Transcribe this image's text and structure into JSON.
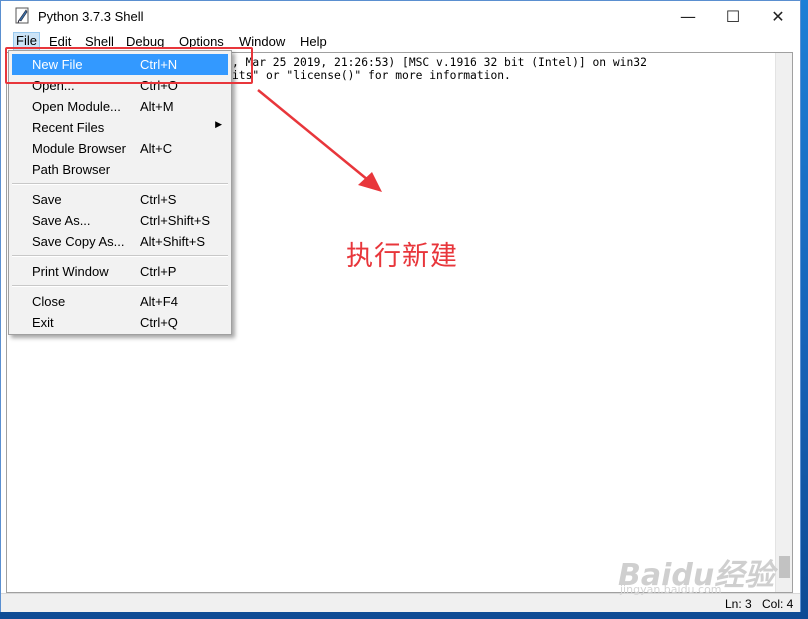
{
  "window": {
    "title": "Python 3.7.3 Shell",
    "controls": {
      "minimize": "—",
      "maximize": "☐",
      "close": "✕"
    }
  },
  "menubar": {
    "items": [
      "File",
      "Edit",
      "Shell",
      "Debug",
      "Options",
      "Window",
      "Help"
    ],
    "active": "File"
  },
  "shell": {
    "line1": ", Mar 25 2019, 21:26:53) [MSC v.1916 32 bit (Intel)] on win32",
    "line2": "its\" or \"license()\" for more information."
  },
  "file_menu": {
    "items": [
      {
        "label": "New File",
        "accel": "Ctrl+N",
        "highlighted": true
      },
      {
        "label": "Open...",
        "accel": "Ctrl+O"
      },
      {
        "label": "Open Module...",
        "accel": "Alt+M"
      },
      {
        "label": "Recent Files",
        "accel": "",
        "submenu": true
      },
      {
        "label": "Module Browser",
        "accel": "Alt+C"
      },
      {
        "label": "Path Browser",
        "accel": ""
      },
      {
        "label": "Save",
        "accel": "Ctrl+S"
      },
      {
        "label": "Save As...",
        "accel": "Ctrl+Shift+S"
      },
      {
        "label": "Save Copy As...",
        "accel": "Alt+Shift+S"
      },
      {
        "label": "Print Window",
        "accel": "Ctrl+P"
      },
      {
        "label": "Close",
        "accel": "Alt+F4"
      },
      {
        "label": "Exit",
        "accel": "Ctrl+Q"
      }
    ]
  },
  "annotation": {
    "text": "执行新建",
    "color": "#e8363b"
  },
  "status": {
    "line": "Ln: 3",
    "col": "Col: 4"
  },
  "watermark": {
    "main": "Baidu经验",
    "sub": "jingyan.baidu.com"
  },
  "colors": {
    "menu_highlight": "#3399ff",
    "annotation_red": "#e8363b",
    "desktop_blue": "#1763b8"
  }
}
